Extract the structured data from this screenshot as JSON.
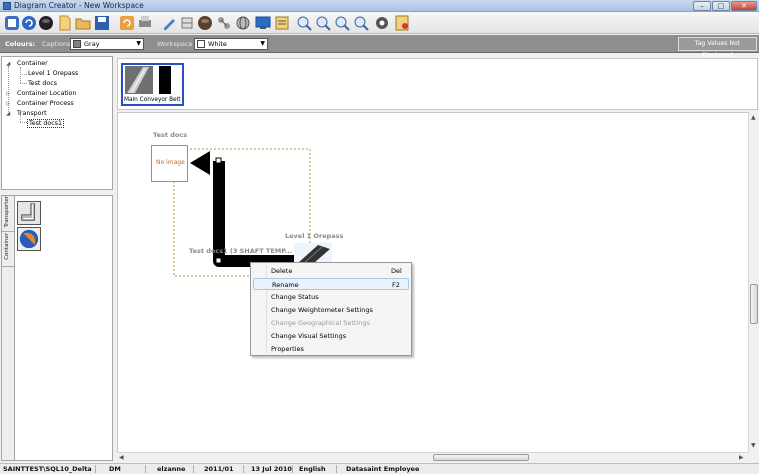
{
  "window": {
    "title": "Diagram Creator - New Workspace",
    "buttons": {
      "minimize": "–",
      "maximize": "□",
      "close": "✕"
    }
  },
  "toolbar": {
    "icons": [
      "new-icon",
      "refresh-icon",
      "circle-icon",
      "document-icon",
      "open-folder-icon",
      "save-icon",
      "undo-icon",
      "print-icon",
      "pencil-icon",
      "layer-icon",
      "node-icon",
      "globe-icon",
      "monitor-icon",
      "properties-icon",
      "zoom-in-icon",
      "zoom-out-icon",
      "zoom-fit-icon",
      "zoom-reset-icon",
      "settings-icon",
      "report-icon"
    ]
  },
  "options": {
    "colours_label": "Colours:",
    "captions_label": "Captions",
    "captions_value": "Gray",
    "captions_color": "#808080",
    "workspace_label": "Workspace",
    "workspace_value": "White",
    "workspace_color": "#ffffff",
    "tag_values_button": "Tag Values Not Displayed"
  },
  "tree": {
    "items": [
      {
        "label": "Container",
        "expander": "◢"
      },
      {
        "label": "Level 1 Orepass"
      },
      {
        "label": "Test docs"
      },
      {
        "label": "Container Location",
        "expander": "▷"
      },
      {
        "label": "Container Process",
        "expander": "▷"
      },
      {
        "label": "Transport",
        "expander": "◢"
      },
      {
        "label": "Test docs1"
      }
    ]
  },
  "palette": {
    "tabs": [
      "Transporter",
      "Container"
    ],
    "items": [
      "transporter-chute-icon",
      "container-ball-icon"
    ]
  },
  "thumbnails": [
    {
      "caption": "Main Conveyor Belt"
    }
  ],
  "diagram": {
    "node_test_docs": {
      "label": "Test docs",
      "placeholder": "No image"
    },
    "node_level1": {
      "label": "Level 1 Orepass"
    },
    "node_test_docs1": {
      "label": "Test docs1 (3 SHAFT TEMP..."
    }
  },
  "context_menu": {
    "items": [
      {
        "label": "Delete",
        "shortcut": "Del"
      },
      {
        "label": "Rename",
        "shortcut": "F2"
      },
      {
        "label": "Change Status",
        "shortcut": ""
      },
      {
        "label": "Change Weightometer Settings",
        "shortcut": ""
      },
      {
        "label": "Change Geographical Settings",
        "shortcut": ""
      },
      {
        "label": "Change Visual Settings",
        "shortcut": ""
      },
      {
        "label": "Properties",
        "shortcut": ""
      }
    ]
  },
  "status": {
    "server": "SAINTTEST\\SQL10_Delta",
    "module": "DM",
    "user": "elzanne",
    "period": "2011/01",
    "date": "13 Jul 2010",
    "language": "English",
    "company": "Datasaint Employee"
  }
}
